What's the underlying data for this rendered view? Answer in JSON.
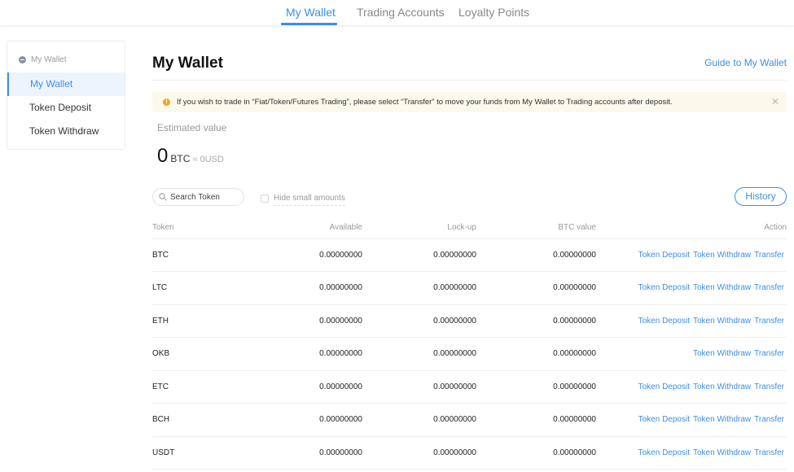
{
  "top_nav": {
    "tabs": [
      {
        "label": "My Wallet",
        "active": true
      },
      {
        "label": "Trading Accounts",
        "active": false
      },
      {
        "label": "Loyalty Points",
        "active": false
      }
    ]
  },
  "sidebar": {
    "group_label": "My Wallet",
    "group_icon": "wallet-icon",
    "items": [
      {
        "label": "My Wallet",
        "active": true
      },
      {
        "label": "Token Deposit",
        "active": false
      },
      {
        "label": "Token Withdraw",
        "active": false
      }
    ]
  },
  "header": {
    "title": "My Wallet",
    "guide_link": "Guide to My Wallet"
  },
  "notice": {
    "icon": "warning-icon",
    "message": "If you wish to trade in “Fiat/Token/Futures Trading”, please select “Transfer” to move your funds from My Wallet to Trading accounts after deposit.",
    "close_icon": "close-icon"
  },
  "estimate": {
    "label": "Estimated value",
    "value": "0",
    "unit": "BTC",
    "usd": "≈ 0USD"
  },
  "filters": {
    "search_placeholder": "Search Token",
    "search_value": "",
    "hide_small_label": "Hide small amounts",
    "hide_small_checked": false,
    "history_button": "History"
  },
  "table": {
    "columns": [
      "Token",
      "Available",
      "Lock-up",
      "BTC value",
      "Action"
    ],
    "rows": [
      {
        "token": "BTC",
        "available": "0.00000000",
        "lockup": "0.00000000",
        "btc_value": "0.00000000",
        "actions": [
          "Token Deposit",
          "Token Withdraw",
          "Transfer"
        ]
      },
      {
        "token": "LTC",
        "available": "0.00000000",
        "lockup": "0.00000000",
        "btc_value": "0.00000000",
        "actions": [
          "Token Deposit",
          "Token Withdraw",
          "Transfer"
        ]
      },
      {
        "token": "ETH",
        "available": "0.00000000",
        "lockup": "0.00000000",
        "btc_value": "0.00000000",
        "actions": [
          "Token Deposit",
          "Token Withdraw",
          "Transfer"
        ]
      },
      {
        "token": "OKB",
        "available": "0.00000000",
        "lockup": "0.00000000",
        "btc_value": "0.00000000",
        "actions": [
          "Token Withdraw",
          "Transfer"
        ]
      },
      {
        "token": "ETC",
        "available": "0.00000000",
        "lockup": "0.00000000",
        "btc_value": "0.00000000",
        "actions": [
          "Token Deposit",
          "Token Withdraw",
          "Transfer"
        ]
      },
      {
        "token": "BCH",
        "available": "0.00000000",
        "lockup": "0.00000000",
        "btc_value": "0.00000000",
        "actions": [
          "Token Deposit",
          "Token Withdraw",
          "Transfer"
        ]
      },
      {
        "token": "USDT",
        "available": "0.00000000",
        "lockup": "0.00000000",
        "btc_value": "0.00000000",
        "actions": [
          "Token Deposit",
          "Token Withdraw",
          "Transfer"
        ]
      }
    ]
  },
  "colors": {
    "accent": "#3c8ee8",
    "notice_bg": "#fdf8ec",
    "warning": "#f5a623",
    "sidebar_active_bg": "#eef4fd"
  }
}
